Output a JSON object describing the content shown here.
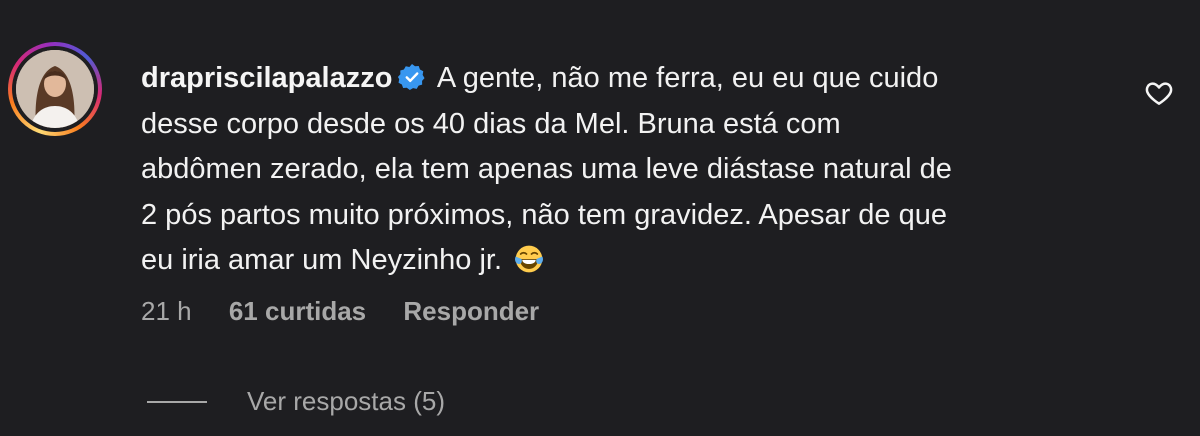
{
  "comment": {
    "username": "drapriscilapalazzo",
    "verified": true,
    "lines": [
      "A gente, não me ferra, eu eu que cuido",
      "desse corpo desde os 40 dias da Mel. Bruna está com",
      "abdômen zerado, ela tem apenas uma leve diástase natural de",
      "2 pós partos muito próximos, não tem gravidez. Apesar de que",
      "eu iria amar um Neyzinho jr."
    ],
    "emoji": "face-with-tears-of-joy",
    "time": "21 h",
    "likes": "61 curtidas",
    "reply_label": "Responder",
    "view_replies": "Ver respostas (5)"
  },
  "icons": {
    "verified": "verified-badge-icon",
    "like": "heart-icon"
  },
  "colors": {
    "background": "#1e1e21",
    "text": "#f2f2f2",
    "muted": "#a8a8a8",
    "verified": "#3897f0"
  }
}
